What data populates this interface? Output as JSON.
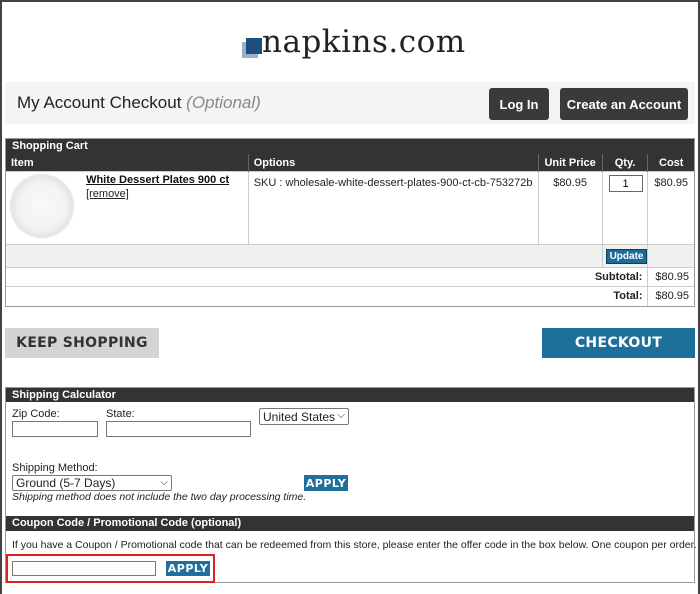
{
  "brand": {
    "name": "napkins.com",
    "colors": {
      "primary": "#1e6f9b",
      "dark": "#333333",
      "highlight": "#e02020"
    }
  },
  "account": {
    "title": "My Account Checkout",
    "optional": "(Optional)",
    "login_label": "Log In",
    "create_label": "Create an Account"
  },
  "cart": {
    "heading": "Shopping Cart",
    "columns": [
      "Item",
      "Options",
      "Unit Price",
      "Qty.",
      "Cost"
    ],
    "items": [
      {
        "name": "White Dessert Plates 900 ct",
        "remove": "[remove]",
        "options": "SKU : wholesale-white-dessert-plates-900-ct-cb-753272b",
        "unit_price": "$80.95",
        "qty": "1",
        "cost": "$80.95"
      }
    ],
    "update_label": "Update",
    "subtotal_label": "Subtotal:",
    "subtotal": "$80.95",
    "total_label": "Total:",
    "total": "$80.95"
  },
  "actions": {
    "keep_shopping": "KEEP SHOPPING",
    "checkout": "CHECKOUT"
  },
  "shipping": {
    "heading": "Shipping Calculator",
    "zip_label": "Zip Code:",
    "state_label": "State:",
    "country": "United States",
    "method_label": "Shipping Method:",
    "method": "Ground (5-7 Days)",
    "apply_label": "APPLY",
    "note": "Shipping method does not include the two day processing time."
  },
  "coupon": {
    "heading": "Coupon Code / Promotional Code (optional)",
    "text": "If you have a Coupon / Promotional code that can be redeemed from this store, please enter the offer code in the box below. One coupon per order.",
    "apply_label": "APPLY"
  }
}
